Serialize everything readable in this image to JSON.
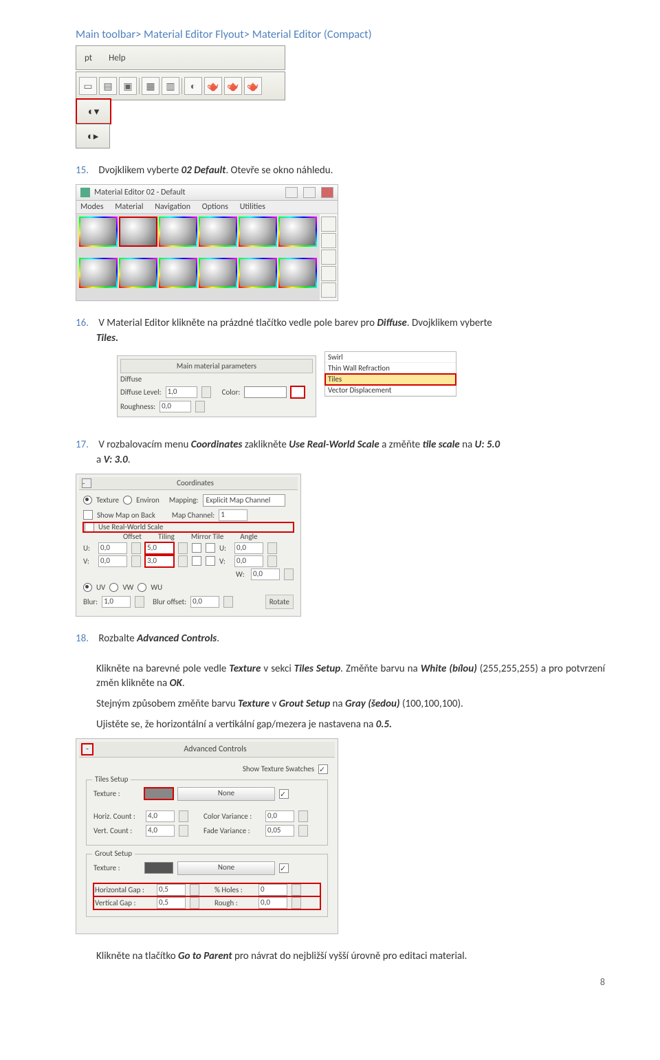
{
  "breadcrumb": "Main toolbar> Material Editor Flyout> Material Editor (Compact)",
  "toolbar": {
    "menu1": "pt",
    "menu2": "Help"
  },
  "steps": {
    "s15": {
      "num": "15.",
      "text_a": "Dvojklikem vyberte ",
      "bold_a": "02 Default",
      "text_b": ". Otevře se okno náhledu."
    },
    "s16": {
      "num": "16.",
      "text_a": "V Material Editor klikněte na prázdné tlačítko vedle pole barev pro ",
      "bold_a": "Diffuse",
      "text_b": ". Dvojklikem vyberte ",
      "bold_b": "Tiles."
    },
    "s17": {
      "num": "17.",
      "text_a": "V rozbalovacím menu ",
      "bold_a": "Coordinates",
      "text_b": " zaklikněte ",
      "bold_b": "Use Real-World Scale",
      "text_c": " a změňte ",
      "bold_c": "tile scale",
      "text_d": " na ",
      "bold_d": "U: 5.0",
      "text_e": " a ",
      "bold_e": "V: 3.0",
      "text_f": "."
    },
    "s18": {
      "num": "18.",
      "text_a": "Rozbalte ",
      "bold_a": "Advanced Controls",
      "text_b": "."
    }
  },
  "para": {
    "p1_a": "Klikněte na barevné pole vedle ",
    "p1_b": "Texture",
    "p1_c": " v sekci ",
    "p1_d": "Tiles Setup",
    "p1_e": ". Změňte barvu na ",
    "p1_f": "White (bílou)",
    "p1_g": " (255,255,255) a pro potvrzení změn klikněte na ",
    "p1_h": "OK",
    "p1_i": ".",
    "p2_a": "Stejným způsobem změňte barvu ",
    "p2_b": "Texture",
    "p2_c": " v ",
    "p2_d": "Grout Setup",
    "p2_e": " na ",
    "p2_f": "Gray (šedou)",
    "p2_g": " (100,100,100).",
    "p3_a": "Ujistěte se, že horizontální a vertikální gap/mezera je nastavena na ",
    "p3_b": "0.5.",
    "p4_a": "Klikněte na tlačítko ",
    "p4_b": "Go to Parent",
    "p4_c": " pro návrat do nejbližší vyšší úrovně pro editaci material."
  },
  "material_editor": {
    "title": "Material Editor 02 - Default",
    "menus": [
      "Modes",
      "Material",
      "Navigation",
      "Options",
      "Utilities"
    ]
  },
  "main_params": {
    "header": "Main material parameters",
    "diffuse": "Diffuse",
    "diffuse_level": "Diffuse Level:",
    "dl_val": "1,0",
    "color": "Color:",
    "roughness": "Roughness:",
    "r_val": "0,0"
  },
  "typelist": [
    "Swirl",
    "Thin Wall Refraction",
    "Tiles",
    "Vector Displacement"
  ],
  "coords": {
    "header": "Coordinates",
    "texture": "Texture",
    "environ": "Environ",
    "mapping": "Mapping:",
    "mapping_val": "Explicit Map Channel",
    "show_map": "Show Map on Back",
    "map_channel": "Map Channel:",
    "mc_val": "1",
    "use_real": "Use Real-World Scale",
    "offset": "Offset",
    "tiling": "Tiling",
    "mirror": "Mirror Tile",
    "angle": "Angle",
    "u": "U:",
    "v": "V:",
    "w": "W:",
    "u_off": "0,0",
    "u_til": "5,0",
    "u_ang": "0,0",
    "v_off": "0,0",
    "v_til": "3,0",
    "v_ang": "0,0",
    "w_ang": "0,0",
    "uv": "UV",
    "vw": "VW",
    "wu": "WU",
    "blur": "Blur:",
    "blur_val": "1,0",
    "blur_off": "Blur offset:",
    "blur_off_val": "0,0",
    "rotate": "Rotate"
  },
  "adv": {
    "header": "Advanced Controls",
    "show_sw": "Show Texture Swatches",
    "tiles_setup": "Tiles Setup",
    "grout_setup": "Grout Setup",
    "texture": "Texture :",
    "none": "None",
    "horiz_count": "Horiz. Count :",
    "hc": "4,0",
    "vert_count": "Vert. Count :",
    "vc": "4,0",
    "color_var": "Color Variance :",
    "cv": "0,0",
    "fade_var": "Fade Variance :",
    "fv": "0,05",
    "h_gap": "Horizontal Gap :",
    "hg": "0,5",
    "v_gap": "Vertical Gap :",
    "vg": "0,5",
    "holes": "% Holes :",
    "ho": "0",
    "rough": "Rough :",
    "ro": "0,0"
  },
  "page_num": "8"
}
